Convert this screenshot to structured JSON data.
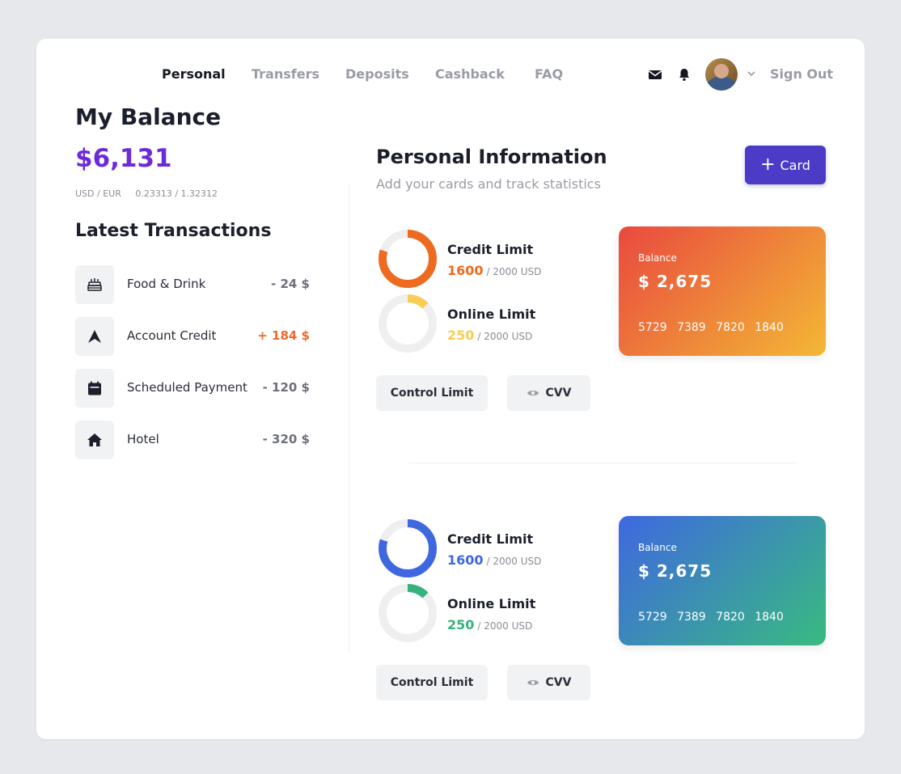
{
  "nav": {
    "links": [
      "Personal",
      "Transfers",
      "Deposits",
      "Cashback",
      "FAQ"
    ],
    "active": "Personal",
    "sign_out": "Sign Out",
    "icons": [
      "mail-icon",
      "bell-icon",
      "avatar",
      "chevron-down-icon"
    ]
  },
  "balance": {
    "title": "My Balance",
    "amount": "$6,131",
    "currency_pair": "USD / EUR",
    "rate": "0.23313 / 1.32312",
    "accent": "#6d2bd8"
  },
  "transactions": {
    "title": "Latest Transactions",
    "items": [
      {
        "name": "Food & Drink",
        "amount": "- 24 $",
        "icon": "cake-icon"
      },
      {
        "name": "Account Credit",
        "amount": "+ 184 $",
        "icon": "arrow-up-icon"
      },
      {
        "name": "Scheduled Payment",
        "amount": "- 120 $",
        "icon": "calendar-icon"
      },
      {
        "name": "Hotel",
        "amount": "- 320 $",
        "icon": "home-icon"
      }
    ]
  },
  "personal": {
    "title": "Personal Information",
    "subtitle": "Add your cards and track statistics",
    "add_card_label": "Card"
  },
  "cards": [
    {
      "credit_title": "Credit Limit",
      "credit_value": "1600",
      "credit_of": "/ 2000 USD",
      "credit_color": "#ee6a1f",
      "online_title": "Online Limit",
      "online_value": "250",
      "online_of": "/ 2000 USD",
      "online_color": "#f7cd55",
      "control_label": "Control Limit",
      "cvv_label": "CVV",
      "card_balance_label": "Balance",
      "card_balance": "$ 2,675",
      "card_number": "5729 7389 7820 1840",
      "gradient_from": "#e9493f",
      "gradient_to": "#f3b835"
    },
    {
      "credit_title": "Credit Limit",
      "credit_value": "1600",
      "credit_of": "/ 2000 USD",
      "credit_color": "#3f67e0",
      "online_title": "Online Limit",
      "online_value": "250",
      "online_of": "/ 2000 USD",
      "online_color": "#36b27d",
      "control_label": "Control Limit",
      "cvv_label": "CVV",
      "card_balance_label": "Balance",
      "card_balance": "$ 2,675",
      "card_number": "5729 7389 7820 1840",
      "gradient_from": "#3f68e0",
      "gradient_to": "#38bb80"
    }
  ]
}
